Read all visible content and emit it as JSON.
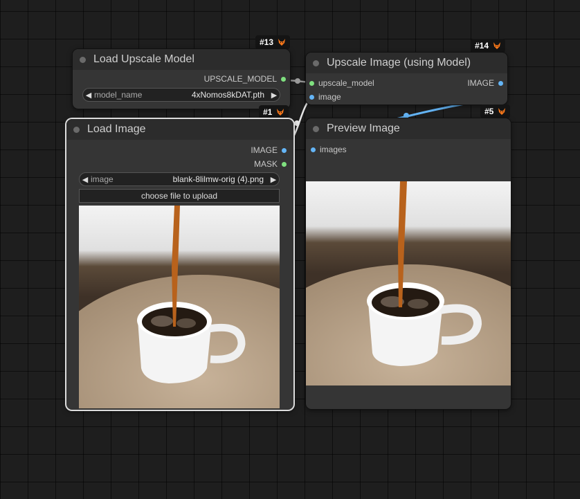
{
  "nodes": {
    "load_upscale_model": {
      "title": "Load Upscale Model",
      "id_badge": "#13",
      "output": "UPSCALE_MODEL",
      "widget": {
        "label": "model_name",
        "value": "4xNomos8kDAT.pth"
      }
    },
    "upscale_image": {
      "title": "Upscale Image (using Model)",
      "id_badge": "#14",
      "inputs": [
        "upscale_model",
        "image"
      ],
      "output": "IMAGE"
    },
    "load_image": {
      "title": "Load Image",
      "id_badge": "#1",
      "outputs": [
        "IMAGE",
        "MASK"
      ],
      "widget": {
        "label": "image",
        "value": "blank-8lilmw-orig (4).png"
      },
      "upload_label": "choose file to upload"
    },
    "preview_image": {
      "title": "Preview Image",
      "id_badge": "#5",
      "input": "images"
    }
  },
  "colors": {
    "canvas": "#1e1e1e",
    "node_body": "#353535",
    "node_header": "#2c2c2c",
    "pin_model": "#7fe07f",
    "pin_image": "#64b5f6",
    "badge_bg": "#141414"
  }
}
